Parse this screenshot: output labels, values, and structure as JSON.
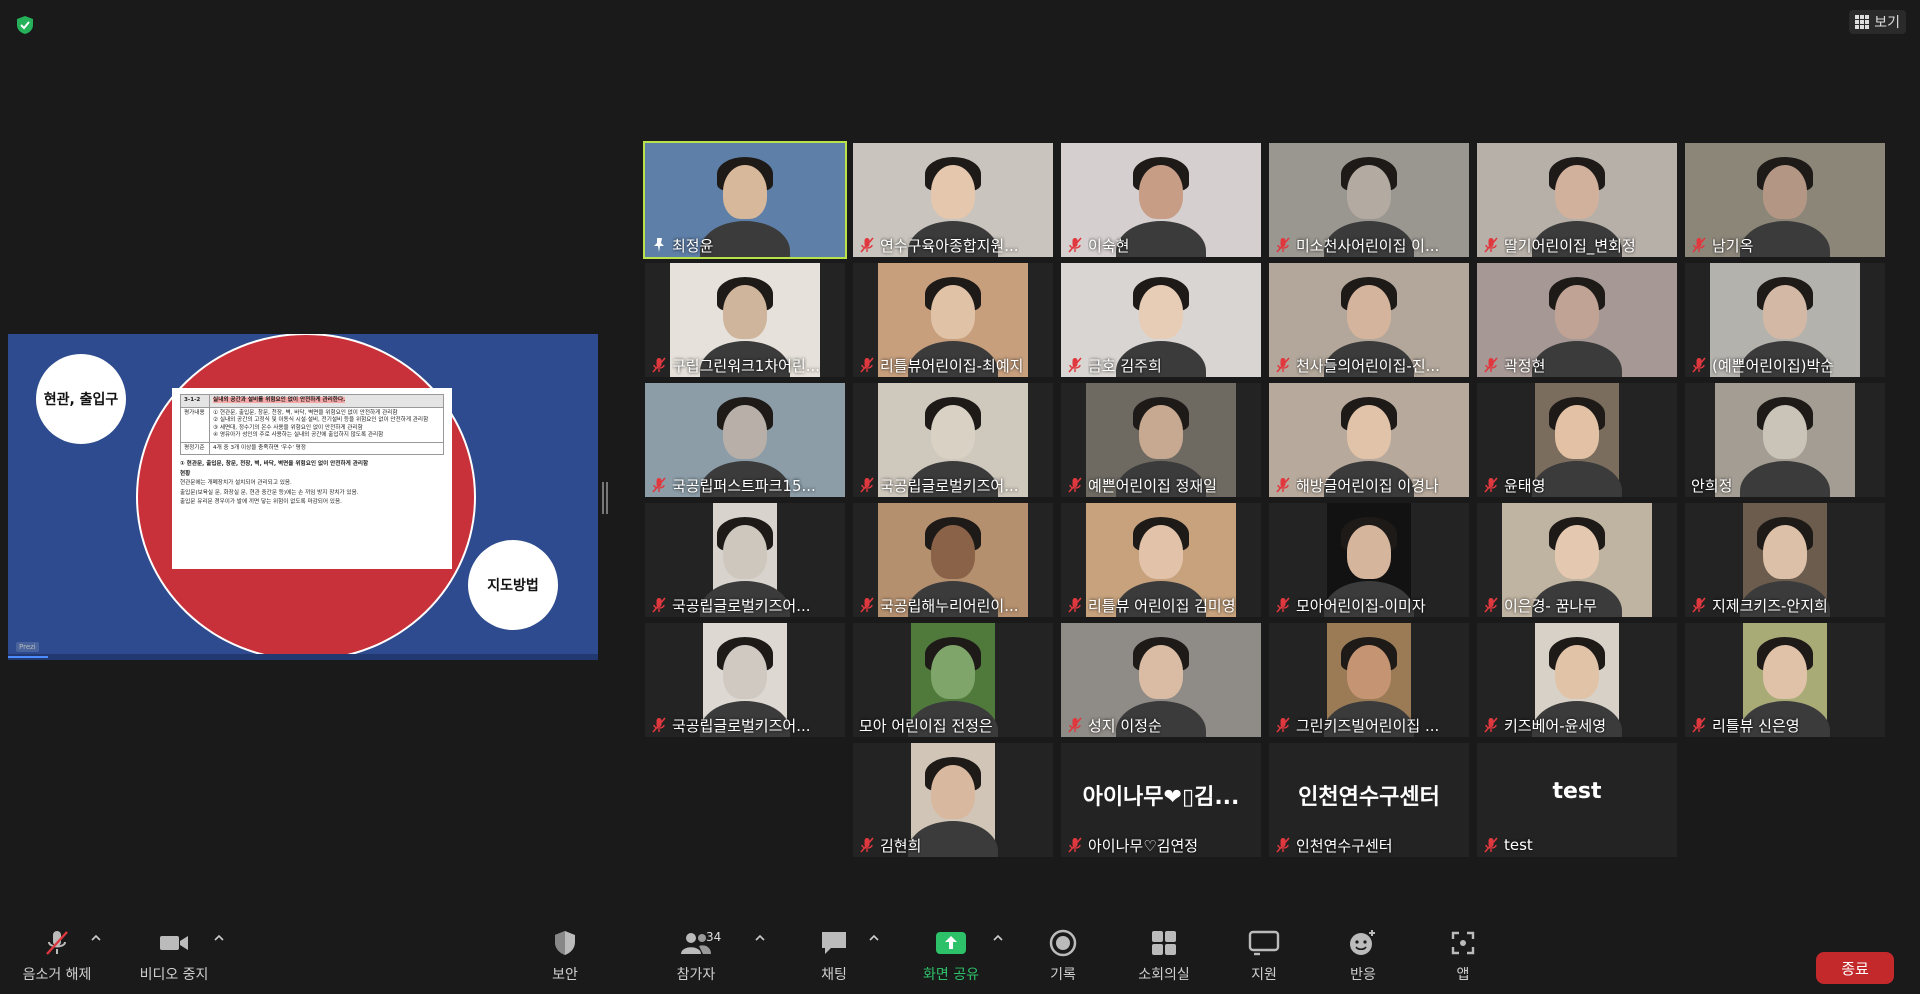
{
  "header": {
    "view_label": "보기"
  },
  "share": {
    "bubble_top": "현관, 출입구",
    "bubble_bottom": "지도방법",
    "doc_code": "3-1-2",
    "doc_heading": "실내외 공간과 설비를 위험요인 없이 안전하게 관리한다.",
    "doc_row_label": "평가내용",
    "doc_items": [
      "① 현관문, 출입문, 창문, 천장, 벽, 바닥, 벽면을 위험요인 없이 안전하게 관리함",
      "② 실내외 공간의 고정식 및 이동식 시설·설비, 전기설비 등을 위험요인 없이 안전하게 관리함",
      "③ 세면대, 정수기의 온수 사용을 위험요인 없이 안전하게 관리함",
      "④ 영유아가 성인의 주로 사용하는 실내외 공간에 출입하지 않도록 관리함"
    ],
    "doc_row2_label": "평정기준",
    "doc_row2_value": "4개 중 3개 이상을 충족하면 '우수' 평정",
    "doc_body_title": "① 현관문, 출입문, 창문, 천장, 벽, 바닥, 벽면을 위험요인 없이 안전하게 관리함",
    "doc_section": "현황",
    "doc_bullets": [
      "현관문에는 개폐장치가 설치되어 관리되고 있음.",
      "출입문(보육실 문, 화장실 문, 현관 중간문 등)에는 손 끼임 방지 장치가 있음.",
      "출입문 유리문 경우이가 발에 끼면 닿는 위험이 없도록 마감되어 있음."
    ],
    "prezi_label": "Prezi"
  },
  "participants": [
    {
      "name": "최정윤",
      "status": "pin",
      "active": true,
      "bg": "#5e7fa8",
      "skin": "#d8b89a"
    },
    {
      "name": "연수구육아종합지원...",
      "status": "muted",
      "bg": "#c9c4bd",
      "skin": "#e4c7ad"
    },
    {
      "name": "이숙현",
      "status": "muted",
      "bg": "#d6cfcf",
      "skin": "#c79d86"
    },
    {
      "name": "미소천사어린이집 이...",
      "status": "muted",
      "bg": "#9a9690",
      "skin": "#b3aaa2"
    },
    {
      "name": "딸기어린이집_변회정",
      "status": "muted",
      "bg": "#b7b0a8",
      "skin": "#d2b19c"
    },
    {
      "name": "남기옥",
      "status": "muted",
      "bg": "#8c8679",
      "skin": "#b39684"
    },
    {
      "name": "구립그린워크1차어린...",
      "status": "muted",
      "bg": "#e6e1da",
      "skin": "#d0b59d"
    },
    {
      "name": "리틀뷰어린이집-최예지",
      "status": "muted",
      "bg": "#c79f7d",
      "skin": "#e0c2a6"
    },
    {
      "name": "금호 김주희",
      "status": "muted",
      "bg": "#d9d5d2",
      "skin": "#e8cdb6"
    },
    {
      "name": "천사들의어린이집-진...",
      "status": "muted",
      "bg": "#b2a79a",
      "skin": "#d4b49c"
    },
    {
      "name": "곽정현",
      "status": "muted",
      "bg": "#a69995",
      "skin": "#c0a394"
    },
    {
      "name": "(예쁜어린이집)박순",
      "status": "muted",
      "bg": "#b4b2ad",
      "skin": "#d3b9a5"
    },
    {
      "name": "국공립퍼스트파크15...",
      "status": "muted",
      "bg": "#8c9da8",
      "skin": "#b8b0a8"
    },
    {
      "name": "국공립글로벌키즈어...",
      "status": "muted",
      "bg": "#cfc8bd",
      "skin": "#d9d1c4"
    },
    {
      "name": "예쁜어린이집 정재일",
      "status": "muted",
      "bg": "#6e6a62",
      "skin": "#c7a890"
    },
    {
      "name": "해방글어린이집 이경나",
      "status": "muted",
      "bg": "#b7a99b",
      "skin": "#e0c3a8"
    },
    {
      "name": "윤태영",
      "status": "muted",
      "bg": "#7a6d5d",
      "skin": "#e2c1a4"
    },
    {
      "name": "안희정",
      "status": "none",
      "bg": "#a39d93",
      "skin": "#c9c3b8"
    },
    {
      "name": "국공립글로벌키즈어...",
      "status": "muted",
      "bg": "#d8d3cc",
      "skin": "#cdc7be"
    },
    {
      "name": "국공립해누리어린이...",
      "status": "muted",
      "bg": "#b5906f",
      "skin": "#8a6248"
    },
    {
      "name": "리틀뷰 어린이집 김미영",
      "status": "muted",
      "bg": "#c7a27d",
      "skin": "#e2c3a9"
    },
    {
      "name": "모아어린이집-이미자",
      "status": "muted",
      "bg": "#121212",
      "skin": "#d6b59d"
    },
    {
      "name": "이은경- 꿈나무",
      "status": "muted",
      "bg": "#bfb3a1",
      "skin": "#e5c8b0"
    },
    {
      "name": "지제크키즈-안지희",
      "status": "muted",
      "bg": "#6b5c4e",
      "skin": "#dcc0a8"
    },
    {
      "name": "국공립글로벌키즈어...",
      "status": "muted",
      "bg": "#ddd8d2",
      "skin": "#cfc9c2"
    },
    {
      "name": "모아 어린이집 전정은",
      "status": "none",
      "bg": "#4f7a3c",
      "skin": "#7fa56a"
    },
    {
      "name": "성지 이정순",
      "status": "muted",
      "bg": "#8f8b86",
      "skin": "#d9bca3"
    },
    {
      "name": "그린키즈빌어린이집 ...",
      "status": "muted",
      "bg": "#9b7b56",
      "skin": "#c49473"
    },
    {
      "name": "키즈베어-윤세영",
      "status": "muted",
      "bg": "#d8d1c7",
      "skin": "#e1c3a8"
    },
    {
      "name": "리틀뷰 신은영",
      "status": "muted",
      "bg": "#a9ab77",
      "skin": "#dfc2a7"
    },
    {
      "name": "김현희",
      "status": "muted",
      "bg": "#d1c5b7",
      "skin": "#d8b89e"
    },
    {
      "name": "아이나무♡김연정",
      "status": "muted",
      "big": "아이나무❤▯김..."
    },
    {
      "name": "인천연수구센터",
      "status": "muted",
      "big": "인천연수구센터"
    },
    {
      "name": "test",
      "status": "muted",
      "big": "test"
    }
  ],
  "toolbar": {
    "unmute": "음소거 해제",
    "video": "비디오 중지",
    "security": "보안",
    "participants": "참가자",
    "participants_count": "34",
    "chat": "채팅",
    "share": "화면 공유",
    "record": "기록",
    "breakout": "소회의실",
    "support": "지원",
    "reactions": "반응",
    "apps": "앱",
    "end": "종료"
  },
  "colors": {
    "active_border": "#b9e24a",
    "mute_red": "#e0383e",
    "share_green": "#2dc16a",
    "end_red": "#c3282b"
  }
}
